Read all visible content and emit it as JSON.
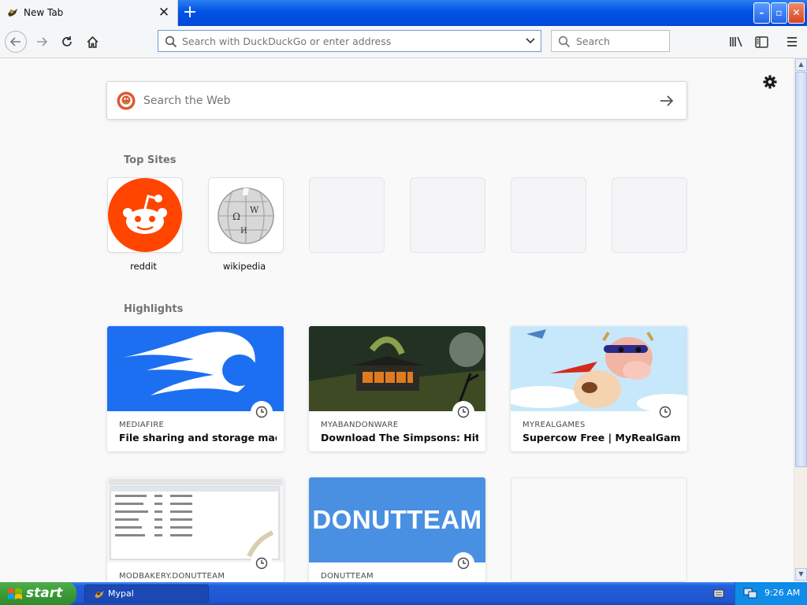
{
  "window": {
    "tab_title": "New Tab",
    "new_tab_label": "+",
    "controls": {
      "minimize": "–",
      "maximize": "▫",
      "close": "✕"
    }
  },
  "toolbar": {
    "url_placeholder": "Search with DuckDuckGo or enter address",
    "search_placeholder": "Search"
  },
  "newtab": {
    "web_search_placeholder": "Search the Web",
    "top_sites_heading": "Top Sites",
    "top_sites": [
      {
        "label": "reddit",
        "icon": "reddit-icon"
      },
      {
        "label": "wikipedia",
        "icon": "wikipedia-icon"
      },
      {
        "label": ""
      },
      {
        "label": ""
      },
      {
        "label": ""
      },
      {
        "label": ""
      }
    ],
    "highlights_heading": "Highlights",
    "highlights": [
      {
        "source": "MEDIAFIRE",
        "title": "File sharing and storage made si..."
      },
      {
        "source": "MYABANDONWARE",
        "title": "Download The Simpsons: Hit & ..."
      },
      {
        "source": "MYREALGAMES",
        "title": "Supercow Free | MyRealGames...."
      },
      {
        "source": "MODBAKERY.DONUTTEAM",
        "title": ""
      },
      {
        "source": "DONUTTEAM",
        "title": "",
        "thumb_text": "DONUTTEAM"
      },
      {
        "source": "",
        "title": ""
      }
    ]
  },
  "taskbar": {
    "start_label": "start",
    "task_label": "Mypal",
    "clock": "9:26 AM"
  },
  "colors": {
    "xp_blue": "#0052e6",
    "reddit": "#ff4500",
    "mediafire": "#1d6ff2",
    "donutteam": "#4a90e2"
  }
}
